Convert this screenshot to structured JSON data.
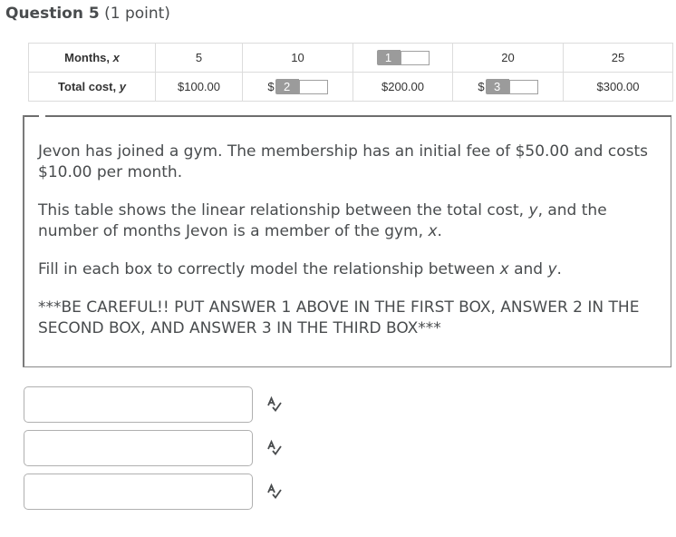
{
  "question": {
    "title": "Question 5",
    "points": "(1 point)"
  },
  "table": {
    "rows": [
      {
        "header_label": "Months, ",
        "header_var": "x",
        "cells": [
          "5",
          "10",
          "",
          "20",
          "25"
        ]
      },
      {
        "header_label": "Total cost, ",
        "header_var": "y",
        "cells": [
          "$100.00",
          "",
          "$200.00",
          "",
          "$300.00"
        ]
      }
    ],
    "blanks": [
      {
        "number": "1",
        "prefix": ""
      },
      {
        "number": "2",
        "prefix": "$"
      },
      {
        "number": "3",
        "prefix": "$"
      }
    ]
  },
  "prompt": {
    "p1": "Jevon has joined a gym. The membership has an initial fee of $50.00 and costs $10.00 per month.",
    "p2_a": "This table shows the linear relationship between the total cost, ",
    "p2_y": "y",
    "p2_b": ", and the number of months Jevon is a member of the gym, ",
    "p2_x": "x",
    "p2_c": ".",
    "p3_a": "Fill in each box to correctly model the relationship between ",
    "p3_x": "x",
    "p3_b": " and ",
    "p3_y": "y",
    "p3_c": ".",
    "p4": "***BE CAREFUL!!  PUT ANSWER 1 ABOVE IN THE FIRST BOX, ANSWER 2 IN THE SECOND BOX, AND ANSWER 3 IN THE THIRD BOX***"
  },
  "answers": [
    {
      "value": "",
      "icon": "spellcheck-icon"
    },
    {
      "value": "",
      "icon": "spellcheck-icon"
    },
    {
      "value": "",
      "icon": "spellcheck-icon"
    }
  ],
  "colors": {
    "text": "#494c4e",
    "blank_tag": "#9b9b9b",
    "border": "#dcdcdc"
  }
}
